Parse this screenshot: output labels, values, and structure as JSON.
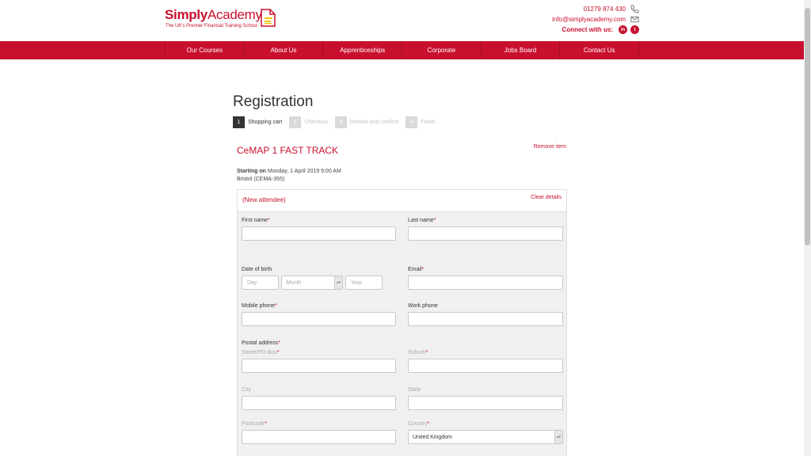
{
  "header": {
    "logo_name_bold": "Simply",
    "logo_name_rest": "Academy",
    "logo_tagline": "The UK's Premier Financial Training School",
    "phone": "01279 874 430",
    "email": "info@simplyacademy.com",
    "connect_label": "Connect with us:",
    "social": [
      "in",
      "t"
    ]
  },
  "nav": {
    "items": [
      {
        "label": "Our Courses"
      },
      {
        "label": "About Us"
      },
      {
        "label": "Apprenticeships"
      },
      {
        "label": "Corporate"
      },
      {
        "label": "Jobs Board"
      },
      {
        "label": "Contact Us"
      }
    ]
  },
  "registration": {
    "title": "Registration",
    "steps": [
      {
        "num": "1",
        "label": "Shopping cart"
      },
      {
        "num": "2",
        "label": "Checkout"
      },
      {
        "num": "3",
        "label": "Review and confirm"
      },
      {
        "num": "4",
        "label": "Finish"
      }
    ],
    "course_title": "CeMAP 1 FAST TRACK",
    "remove_label": "Remove item",
    "starting_label": "Starting on",
    "starting_value": "Monday, 1 April 2019 9:00 AM",
    "location": "Bristol (CEMA-355)"
  },
  "attendee": {
    "title": "(New attendee)",
    "clear_label": "Clear details",
    "fields": {
      "first_name": "First name",
      "last_name": "Last name",
      "dob": "Date of birth",
      "day_placeholder": "Day",
      "month_placeholder": "Month",
      "year_placeholder": "Year",
      "email": "Email",
      "mobile": "Mobile phone",
      "work": "Work phone",
      "postal": "Postal address",
      "street": "Street/PO Box",
      "suburb": "Suburb",
      "city": "City",
      "state": "State",
      "postcode": "Postcode",
      "country": "Country",
      "country_value": "United Kingdom"
    },
    "required_mark": "*"
  },
  "colors": {
    "brand": "#c8102e"
  }
}
